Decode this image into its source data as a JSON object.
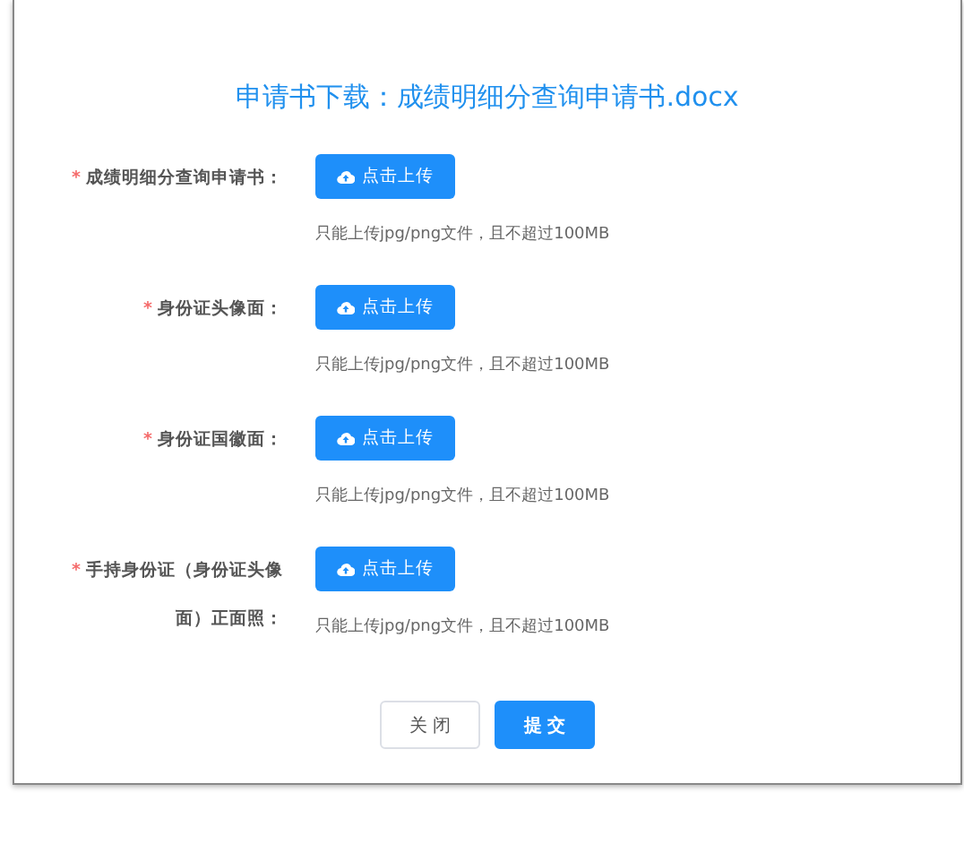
{
  "dialog": {
    "title": "申请书下载：成绩明细分查询申请书.docx",
    "items": [
      {
        "label": "成绩明细分查询申请书：",
        "required_mark": "*",
        "button": "点击上传",
        "hint": "只能上传jpg/png文件，且不超过100MB"
      },
      {
        "label": "身份证头像面：",
        "required_mark": "*",
        "button": "点击上传",
        "hint": "只能上传jpg/png文件，且不超过100MB"
      },
      {
        "label": "身份证国徽面：",
        "required_mark": "*",
        "button": "点击上传",
        "hint": "只能上传jpg/png文件，且不超过100MB"
      },
      {
        "label": "手持身份证（身份证头像面）正面照：",
        "required_mark": "*",
        "button": "点击上传",
        "hint": "只能上传jpg/png文件，且不超过100MB"
      }
    ],
    "buttons": [
      {
        "label": "关 闭",
        "kind": "default"
      },
      {
        "label": "提 交",
        "kind": "primary"
      }
    ]
  }
}
